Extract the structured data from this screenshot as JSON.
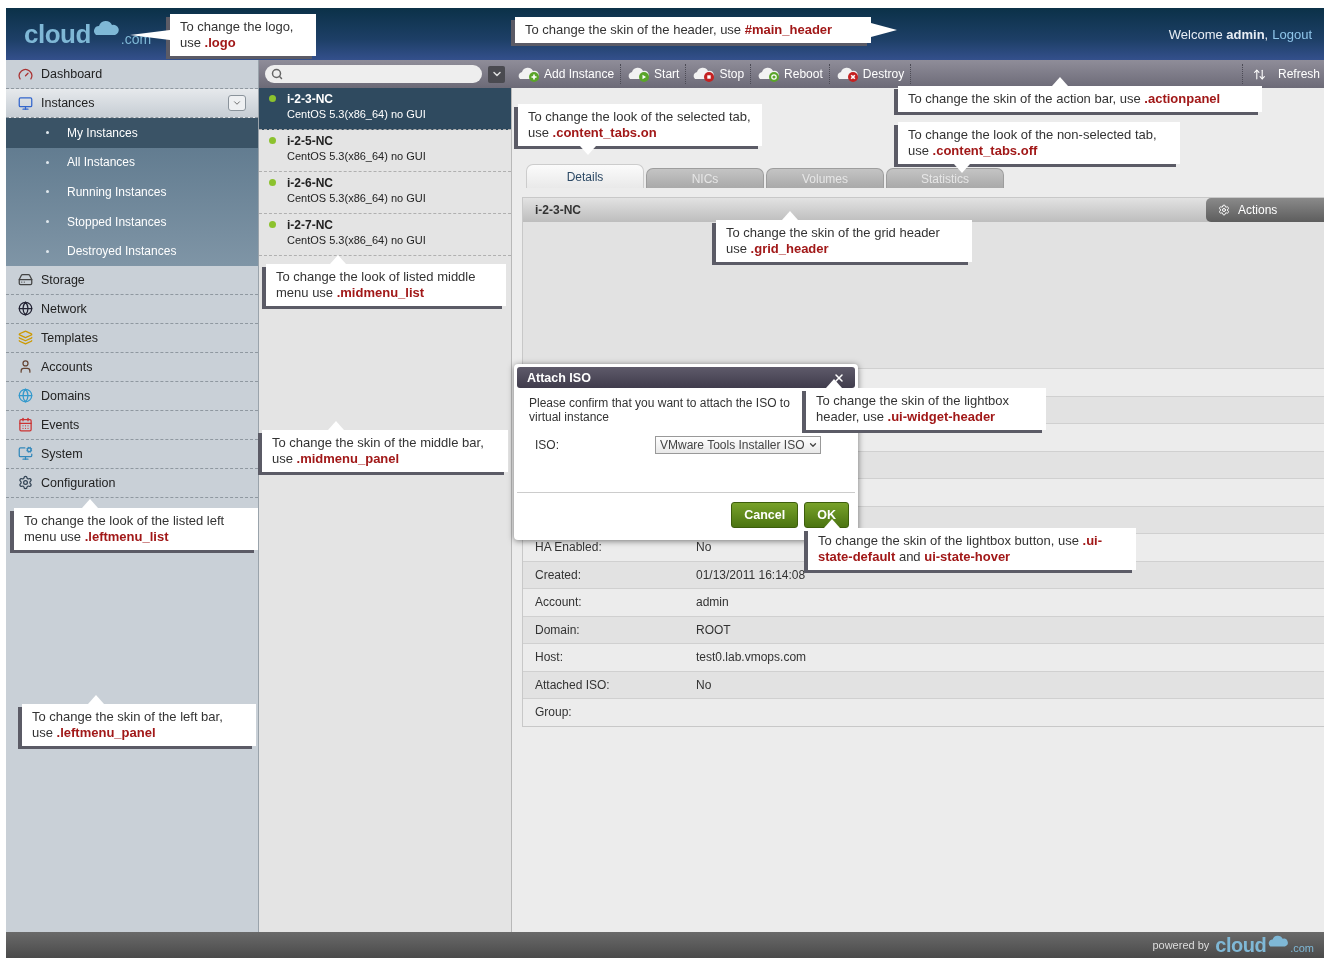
{
  "header": {
    "logo": {
      "name": "cloud",
      "suffix": ".com"
    },
    "welcome": "Welcome **admin**,",
    "logout": "Logout"
  },
  "left_menu": [
    {
      "label": "Dashboard",
      "kind": "item",
      "selected": false
    },
    {
      "label": "Instances",
      "kind": "group",
      "selected": true,
      "expanded": true,
      "children": [
        {
          "label": "My Instances",
          "selected": true
        },
        {
          "label": "All Instances",
          "selected": false
        },
        {
          "label": "Running Instances",
          "selected": false
        },
        {
          "label": "Stopped Instances",
          "selected": false
        },
        {
          "label": "Destroyed Instances",
          "selected": false
        }
      ]
    },
    {
      "label": "Storage",
      "kind": "item",
      "selected": false
    },
    {
      "label": "Network",
      "kind": "item",
      "selected": false
    },
    {
      "label": "Templates",
      "kind": "item",
      "selected": false
    },
    {
      "label": "Accounts",
      "kind": "item",
      "selected": false
    },
    {
      "label": "Domains",
      "kind": "item",
      "selected": false
    },
    {
      "label": "Events",
      "kind": "item",
      "selected": false
    },
    {
      "label": "System",
      "kind": "item",
      "selected": false
    },
    {
      "label": "Configuration",
      "kind": "item",
      "selected": false
    }
  ],
  "action_bar": {
    "actions": [
      {
        "label": "Add Instance",
        "kind": "add"
      },
      {
        "label": "Start",
        "kind": "start"
      },
      {
        "label": "Stop",
        "kind": "stop"
      },
      {
        "label": "Reboot",
        "kind": "reboot"
      },
      {
        "label": "Destroy",
        "kind": "destroy"
      }
    ],
    "refresh": "Refresh"
  },
  "instances": [
    {
      "name": "i-2-3-NC",
      "os": "CentOS 5.3(x86_64) no GUI",
      "selected": true
    },
    {
      "name": "i-2-5-NC",
      "os": "CentOS 5.3(x86_64) no GUI",
      "selected": false
    },
    {
      "name": "i-2-6-NC",
      "os": "CentOS 5.3(x86_64) no GUI",
      "selected": false
    },
    {
      "name": "i-2-7-NC",
      "os": "CentOS 5.3(x86_64) no GUI",
      "selected": false
    }
  ],
  "tabs": [
    {
      "label": "Details",
      "selected": true
    },
    {
      "label": "NICs",
      "selected": false
    },
    {
      "label": "Volumes",
      "selected": false
    },
    {
      "label": "Statistics",
      "selected": false
    }
  ],
  "grid": {
    "title": "i-2-3-NC",
    "actions": "Actions",
    "rows": [
      {
        "label": "HA Enabled:",
        "value": "No"
      },
      {
        "label": "Created:",
        "value": "01/13/2011 16:14:08"
      },
      {
        "label": "Account:",
        "value": "admin"
      },
      {
        "label": "Domain:",
        "value": "ROOT"
      },
      {
        "label": "Host:",
        "value": "test0.lab.vmops.com"
      },
      {
        "label": "Attached ISO:",
        "value": "No"
      },
      {
        "label": "Group:"
      }
    ]
  },
  "dialog": {
    "title": "Attach ISO",
    "message": "Please confirm that you want to attach the ISO to virtual instance",
    "field_label": "ISO:",
    "select_value": "VMware Tools Installer ISO",
    "buttons": [
      "Cancel",
      "OK"
    ]
  },
  "callouts": [
    {
      "text": "To change the logo, use **.logo**"
    },
    {
      "text": "To change the skin of the header, use **#main_header**"
    },
    {
      "text": "To change the skin of the action bar, use **.actionpanel**"
    },
    {
      "text": "To change the look of the selected tab, use **.content_tabs.on**"
    },
    {
      "text": "To change the look of the non-selected tab, use **.content_tabs.off**"
    },
    {
      "text": "To change the skin of the grid header use **.grid_header**"
    },
    {
      "text": "To change the look of listed middle menu use **.midmenu_list**"
    },
    {
      "text": "To change the skin of the middle bar, use **.midmenu_panel**"
    },
    {
      "text": "To change the look of the listed left menu use **.leftmenu_list**"
    },
    {
      "text": "To change the skin of the left bar, use **.leftmenu_panel**"
    },
    {
      "text": "To change the skin of the lightbox header, use **.ui-widget-header**"
    },
    {
      "text": "To change the skin of the lightbox button, use **.ui-state-default** and **ui-state-hover**"
    }
  ],
  "footer": {
    "powered_by": "powered by",
    "logo": {
      "name": "cloud",
      "suffix": ".com"
    }
  }
}
